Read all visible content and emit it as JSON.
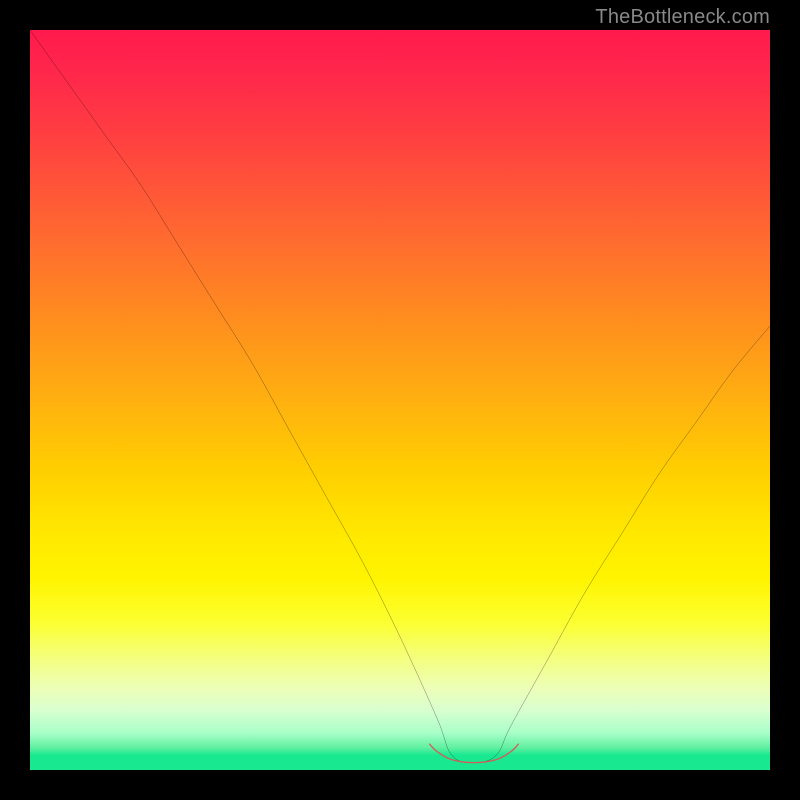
{
  "watermark": "TheBottleneck.com",
  "chart_data": {
    "type": "line",
    "title": "",
    "xlabel": "",
    "ylabel": "",
    "xlim": [
      0,
      100
    ],
    "ylim": [
      0,
      100
    ],
    "series": [
      {
        "name": "bottleneck-curve",
        "x": [
          0,
          5,
          10,
          15,
          20,
          25,
          30,
          35,
          40,
          45,
          50,
          55,
          57,
          60,
          63,
          65,
          70,
          75,
          80,
          85,
          90,
          95,
          100
        ],
        "values": [
          100,
          93,
          86,
          79,
          71,
          63,
          55,
          46,
          37,
          28,
          18,
          7,
          2,
          1,
          2,
          6,
          15,
          24,
          32,
          40,
          47,
          54,
          60
        ]
      },
      {
        "name": "highlight-band",
        "x": [
          54,
          55,
          57,
          60,
          63,
          65,
          66
        ],
        "values": [
          3.5,
          2.5,
          1.4,
          1.0,
          1.4,
          2.5,
          3.5
        ]
      }
    ],
    "annotations": []
  }
}
